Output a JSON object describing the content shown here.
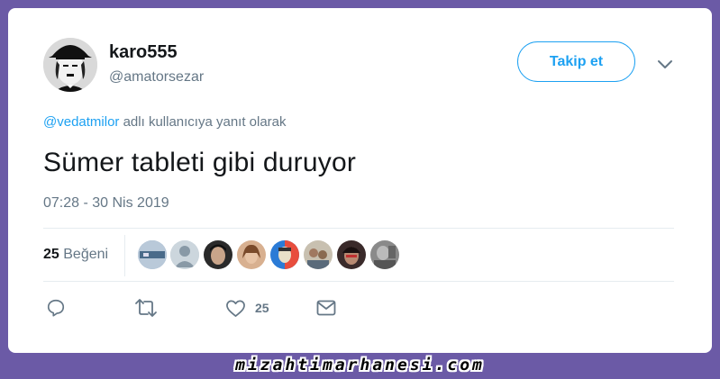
{
  "tweet": {
    "display_name": "karo555",
    "handle": "@amatorsezar",
    "follow_label": "Takip et",
    "reply_mention": "@vedatmilor",
    "reply_suffix": " adlı kullanıcıya yanıt olarak",
    "text": "Sümer tableti gibi duruyor",
    "timestamp": "07:28 - 30 Nis 2019"
  },
  "stats": {
    "likes_number": "25",
    "likes_label": "Beğeni",
    "liker_avatar_count": 8
  },
  "actions": {
    "reply_icon": "reply-icon",
    "retweet_icon": "retweet-icon",
    "like_icon": "heart-icon",
    "like_count": "25",
    "dm_icon": "envelope-icon"
  },
  "watermark": "mizahtimarhanesi.com",
  "colors": {
    "accent": "#1da1f2",
    "secondary_text": "#657786",
    "primary_text": "#14171a",
    "frame": "#6b5aa6"
  }
}
